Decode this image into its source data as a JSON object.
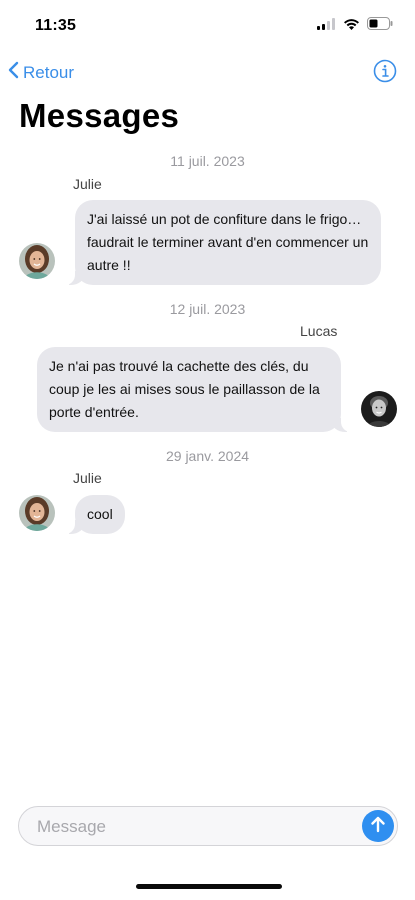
{
  "status_bar": {
    "time": "11:35"
  },
  "nav": {
    "back_label": "Retour",
    "title": "Messages"
  },
  "colors": {
    "accent": "#3a8ee8",
    "bubble": "#e7e7ec",
    "send": "#2f8ff0",
    "date_text": "#9a9a9f"
  },
  "conversation": [
    {
      "date": "11 juil. 2023",
      "sender": "Julie",
      "side": "left",
      "text": "J'ai laissé un pot de confiture dans le frigo… faudrait le terminer avant d'en commencer un autre !!"
    },
    {
      "date": "12 juil. 2023",
      "sender": "Lucas",
      "side": "right",
      "text": "Je n'ai pas trouvé la cachette des clés, du coup je les ai mises sous le paillasson de la porte d'entrée."
    },
    {
      "date": "29 janv. 2024",
      "sender": "Julie",
      "side": "left",
      "text": "cool"
    }
  ],
  "composer": {
    "placeholder": "Message",
    "value": ""
  },
  "icons": {
    "back": "chevron-left-icon",
    "info": "info-circle-icon",
    "send": "arrow-up-icon"
  }
}
